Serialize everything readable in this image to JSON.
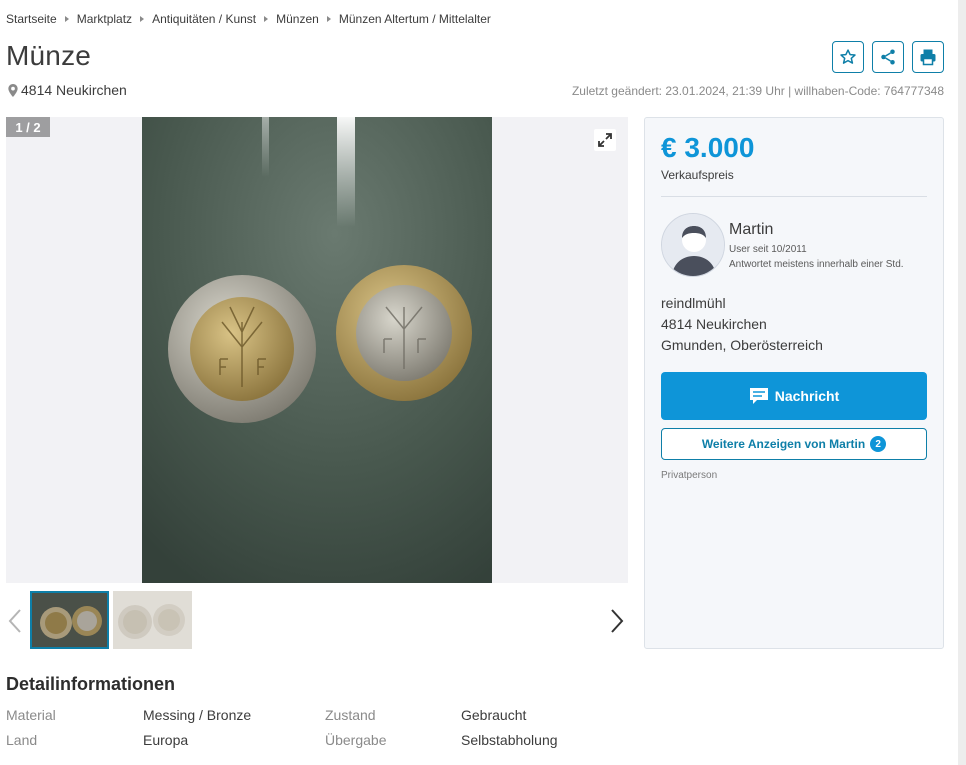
{
  "breadcrumb": [
    "Startseite",
    "Marktplatz",
    "Antiquitäten / Kunst",
    "Münzen",
    "Münzen Altertum / Mittelalter"
  ],
  "listing": {
    "title": "Münze",
    "location": "4814 Neukirchen",
    "meta": "Zuletzt geändert: 23.01.2024, 21:39 Uhr | willhaben-Code: 764777348"
  },
  "gallery": {
    "counter": "1 / 2",
    "image_count": 2,
    "current_index": 1
  },
  "seller": {
    "price": "€ 3.000",
    "price_label": "Verkaufspreis",
    "name": "Martin",
    "since": "User seit 10/2011",
    "response": "Antwortet meistens innerhalb einer Std.",
    "address": [
      "reindlmühl",
      "4814 Neukirchen",
      "Gmunden, Oberösterreich"
    ],
    "message_button": "Nachricht",
    "more_button": "Weitere Anzeigen von Martin",
    "more_count": "2",
    "seller_type": "Privatperson"
  },
  "details": {
    "title": "Detailinformationen",
    "rows": [
      {
        "label": "Material",
        "value": "Messing / Bronze"
      },
      {
        "label": "Zustand",
        "value": "Gebraucht"
      },
      {
        "label": "Land",
        "value": "Europa"
      },
      {
        "label": "Übergabe",
        "value": "Selbstabholung"
      }
    ]
  },
  "colors": {
    "accent": "#0e95d8",
    "accent_dark": "#0e7fa8",
    "photo_bg": "#44554b"
  },
  "icons": [
    "map-pin-icon",
    "star-icon",
    "share-icon",
    "print-icon",
    "expand-icon",
    "chat-icon",
    "chevron-left-icon",
    "chevron-right-icon"
  ]
}
